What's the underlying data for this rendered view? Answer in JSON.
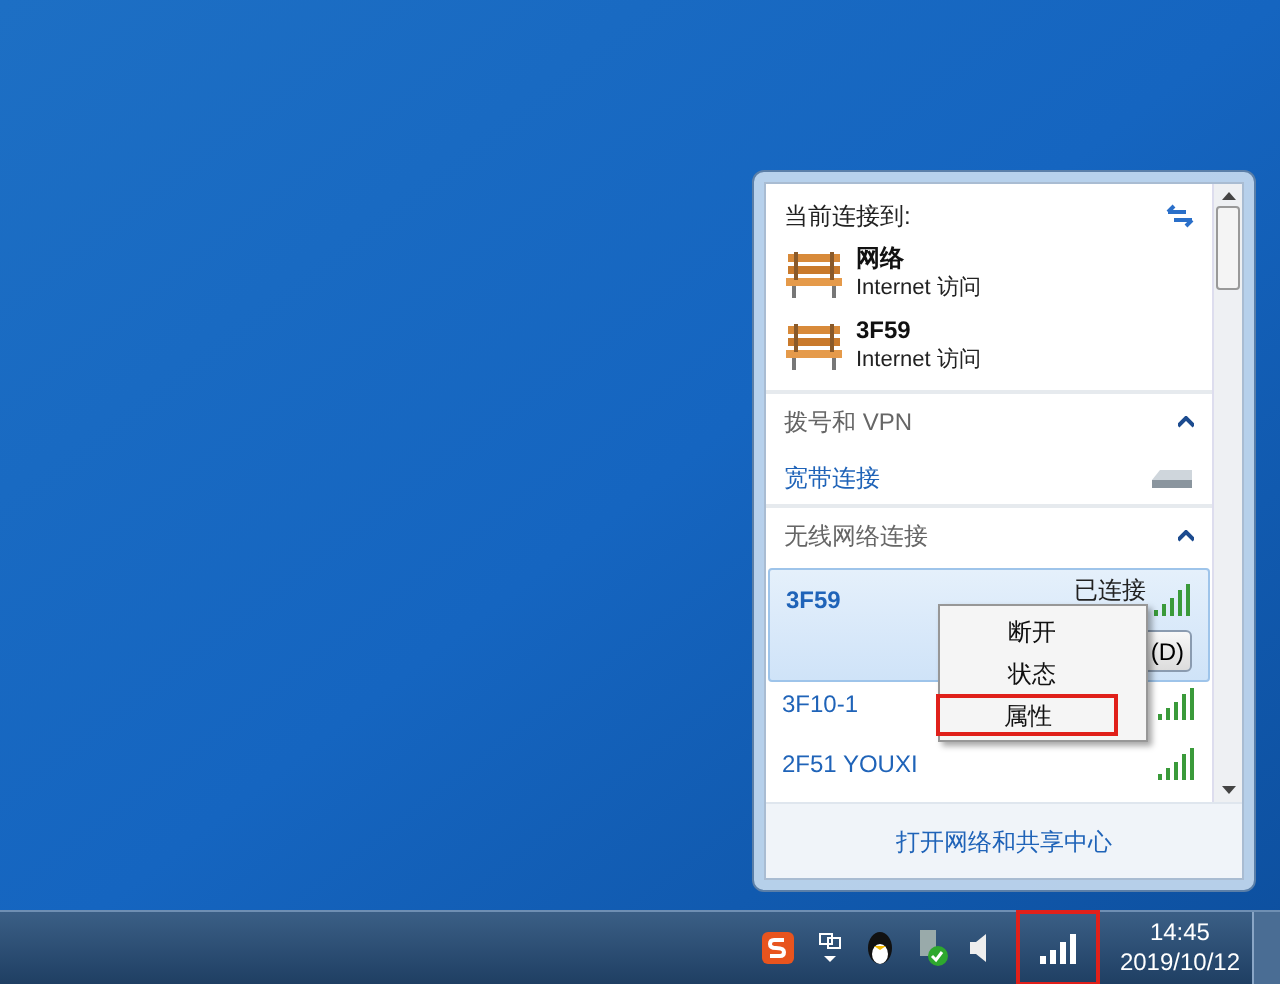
{
  "flyout": {
    "header": "当前连接到:",
    "connections": [
      {
        "name": "网络",
        "access": "Internet 访问"
      },
      {
        "name": "3F59",
        "access": "Internet 访问"
      }
    ],
    "sections": [
      {
        "title": "拨号和 VPN",
        "expanded": true,
        "items": [
          {
            "kind": "dialup",
            "name": "宽带连接"
          }
        ]
      },
      {
        "title": "无线网络连接",
        "expanded": true,
        "items": [
          {
            "kind": "wifi",
            "name": "3F59",
            "selected": true,
            "status": "已连接",
            "button": "(D)"
          },
          {
            "kind": "wifi",
            "name": "3F10-1",
            "selected": false
          },
          {
            "kind": "wifi",
            "name": "2F51 YOUXI",
            "selected": false
          }
        ]
      }
    ],
    "footer_link": "打开网络和共享中心"
  },
  "context_menu": {
    "items": [
      {
        "label": "断开",
        "highlighted": false
      },
      {
        "label": "状态",
        "highlighted": false
      },
      {
        "label": "属性",
        "highlighted": true
      }
    ]
  },
  "taskbar": {
    "time": "14:45",
    "date": "2019/10/12"
  }
}
